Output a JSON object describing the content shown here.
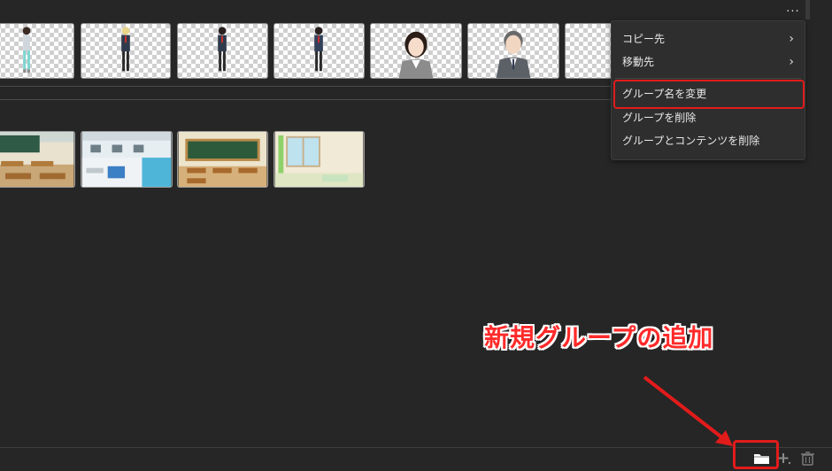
{
  "toolbar": {
    "more_label": "..."
  },
  "context_menu": {
    "items": [
      {
        "label": "コピー先",
        "has_submenu": true
      },
      {
        "label": "移動先",
        "has_submenu": true
      },
      {
        "label": "グループ名を変更",
        "has_submenu": false
      },
      {
        "label": "グループを削除",
        "has_submenu": false
      },
      {
        "label": "グループとコンテンツを削除",
        "has_submenu": false
      }
    ],
    "submenu_glyph": "›"
  },
  "annotation": {
    "text": "新規グループの追加",
    "color": "#ff2a2a"
  },
  "bottom_bar": {
    "icons": [
      "folder-icon",
      "add-icon",
      "trash-icon"
    ]
  },
  "colors": {
    "background": "#262626",
    "highlight": "#e21b1b",
    "menu_bg": "#2e2e2e"
  }
}
